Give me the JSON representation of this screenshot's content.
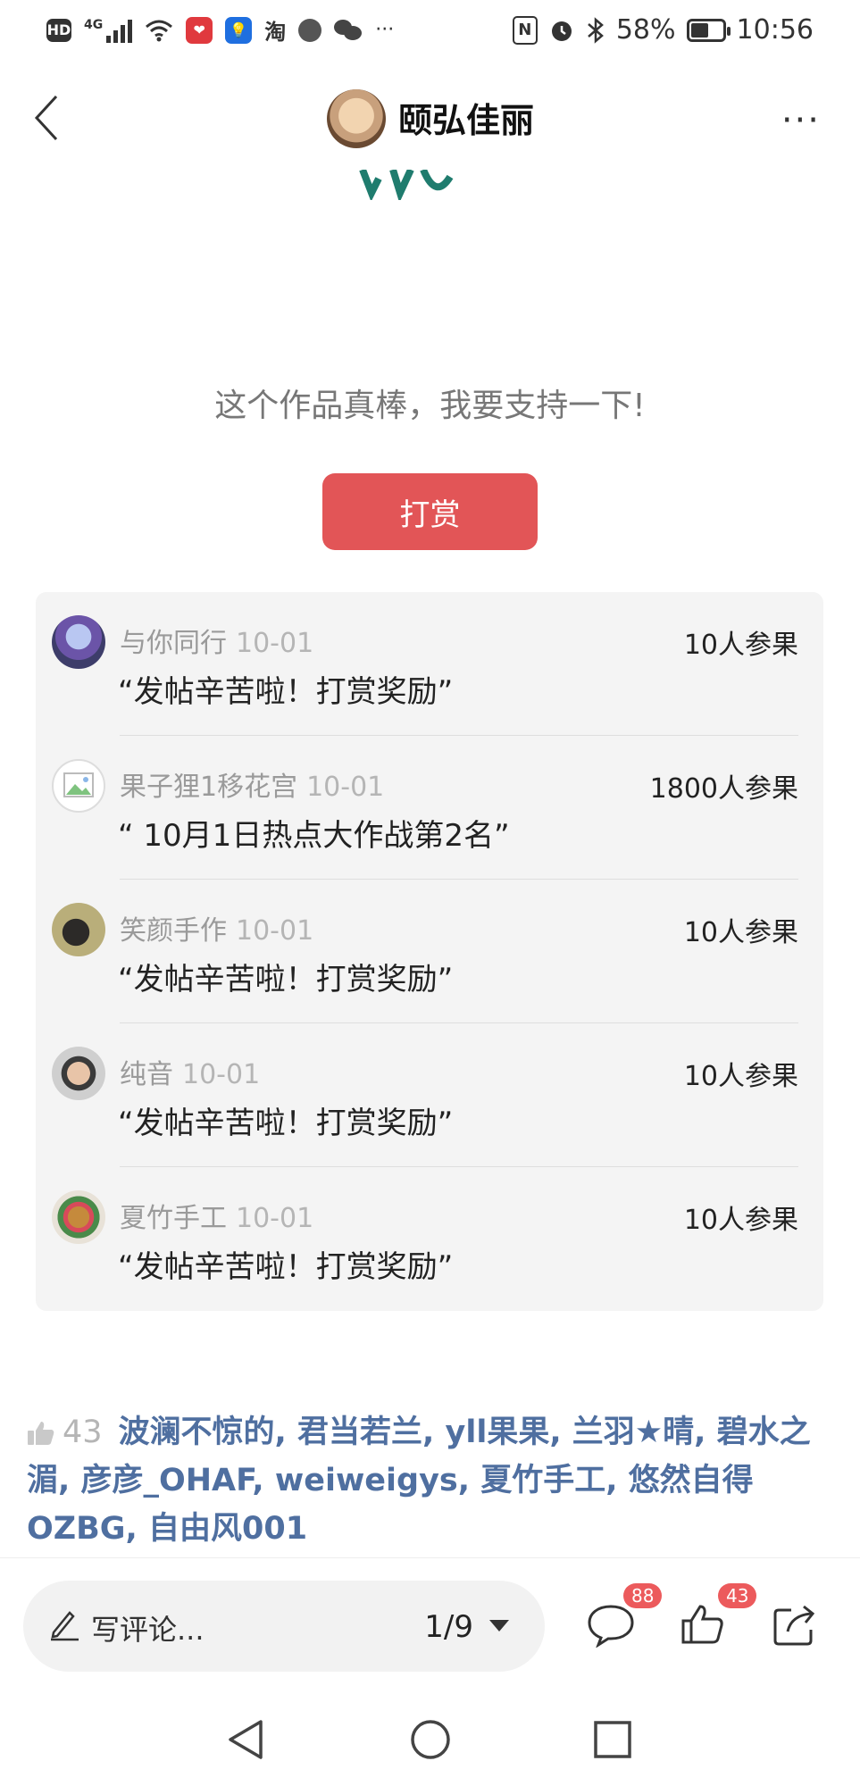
{
  "status": {
    "left_icons": [
      "hd-icon",
      "signal-4g-icon",
      "wifi-icon",
      "pinduoduo-icon",
      "bulb-app-icon",
      "taobao-icon",
      "app-icon",
      "wechat-icon",
      "more-dots-icon"
    ],
    "taobao_glyph": "淘",
    "more": "···",
    "hd": "HD",
    "net": "4G",
    "battery_level": 0.58,
    "battery": "58%",
    "time": "10:56",
    "nfc": "N"
  },
  "header": {
    "title": "颐弘佳丽",
    "more": "···"
  },
  "support_text": "这个作品真棒，我要支持一下!",
  "tip_button": "打赏",
  "rewards": [
    {
      "name": "与你同行",
      "date": "10-01",
      "count": "10人参果",
      "message": "“发帖辛苦啦！打赏奖励”"
    },
    {
      "name": "果子狸1移花宫",
      "date": "10-01",
      "count": "1800人参果",
      "message": "“ 10月1日热点大作战第2名”"
    },
    {
      "name": "笑颜手作",
      "date": "10-01",
      "count": "10人参果",
      "message": "“发帖辛苦啦！打赏奖励”"
    },
    {
      "name": "纯音",
      "date": "10-01",
      "count": "10人参果",
      "message": "“发帖辛苦啦！打赏奖励”"
    },
    {
      "name": "夏竹手工",
      "date": "10-01",
      "count": "10人参果",
      "message": "“发帖辛苦啦！打赏奖励”"
    }
  ],
  "likes": {
    "count": "43",
    "names": "波澜不惊的, 君当若兰, yll果果, 兰羽★晴, 碧水之湄, 彦彦_OHAF, weiweigys, 夏竹手工, 悠然自得OZBG, 自由风001"
  },
  "bottom": {
    "comment_placeholder": "写评论...",
    "page_indicator": "1/9",
    "comment_badge": "88",
    "like_badge": "43"
  },
  "colors": {
    "accent_red": "#e25557",
    "badge_red": "#ec5a5c",
    "link_blue": "#4f6fa0",
    "logo_teal": "#1f7c6e"
  }
}
